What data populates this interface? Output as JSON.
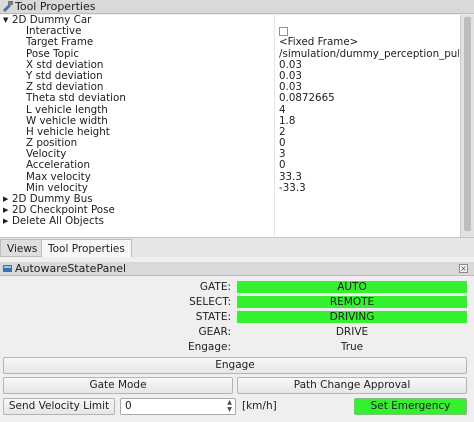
{
  "tool_properties": {
    "title": "Tool Properties",
    "close_glyph": "×",
    "groups": [
      {
        "label": "2D Dummy Car",
        "expanded": true,
        "props": [
          {
            "key": "Interactive",
            "value": ""
          },
          {
            "key": "Target Frame",
            "value": "<Fixed Frame>"
          },
          {
            "key": "Pose Topic",
            "value": "/simulation/dummy_perception_publish..."
          },
          {
            "key": "X std deviation",
            "value": "0.03"
          },
          {
            "key": "Y std deviation",
            "value": "0.03"
          },
          {
            "key": "Z std deviation",
            "value": "0.03"
          },
          {
            "key": "Theta std deviation",
            "value": "0.0872665"
          },
          {
            "key": "L vehicle length",
            "value": "4"
          },
          {
            "key": "W vehicle width",
            "value": "1.8"
          },
          {
            "key": "H vehicle height",
            "value": "2"
          },
          {
            "key": "Z position",
            "value": "0"
          },
          {
            "key": "Velocity",
            "value": "3"
          },
          {
            "key": "Acceleration",
            "value": "0"
          },
          {
            "key": "Max velocity",
            "value": "33.3"
          },
          {
            "key": "Min velocity",
            "value": "-33.3"
          }
        ]
      },
      {
        "label": "2D Dummy Bus",
        "expanded": false
      },
      {
        "label": "2D Checkpoint Pose",
        "expanded": false
      },
      {
        "label": "Delete All Objects",
        "expanded": false
      }
    ]
  },
  "tabs": [
    {
      "label": "Views",
      "active": false
    },
    {
      "label": "Tool Properties",
      "active": true
    }
  ],
  "autoware_panel": {
    "title": "AutowareStatePanel",
    "close_glyph": "×",
    "rows": [
      {
        "label": "GATE:",
        "value": "AUTO",
        "highlight": true
      },
      {
        "label": "SELECT:",
        "value": "REMOTE",
        "highlight": true
      },
      {
        "label": "STATE:",
        "value": "DRIVING",
        "highlight": true
      },
      {
        "label": "GEAR:",
        "value": "DRIVE",
        "highlight": false
      },
      {
        "label": "Engage:",
        "value": "True",
        "highlight": false
      }
    ],
    "engage_button": "Engage",
    "gate_mode_button": "Gate Mode",
    "path_change_button": "Path Change Approval",
    "send_velocity_button": "Send Velocity Limit",
    "velocity_value": "0",
    "velocity_unit": "[km/h]",
    "emergency_button": "Set Emergency"
  },
  "colors": {
    "status_green": "#35f02e"
  }
}
